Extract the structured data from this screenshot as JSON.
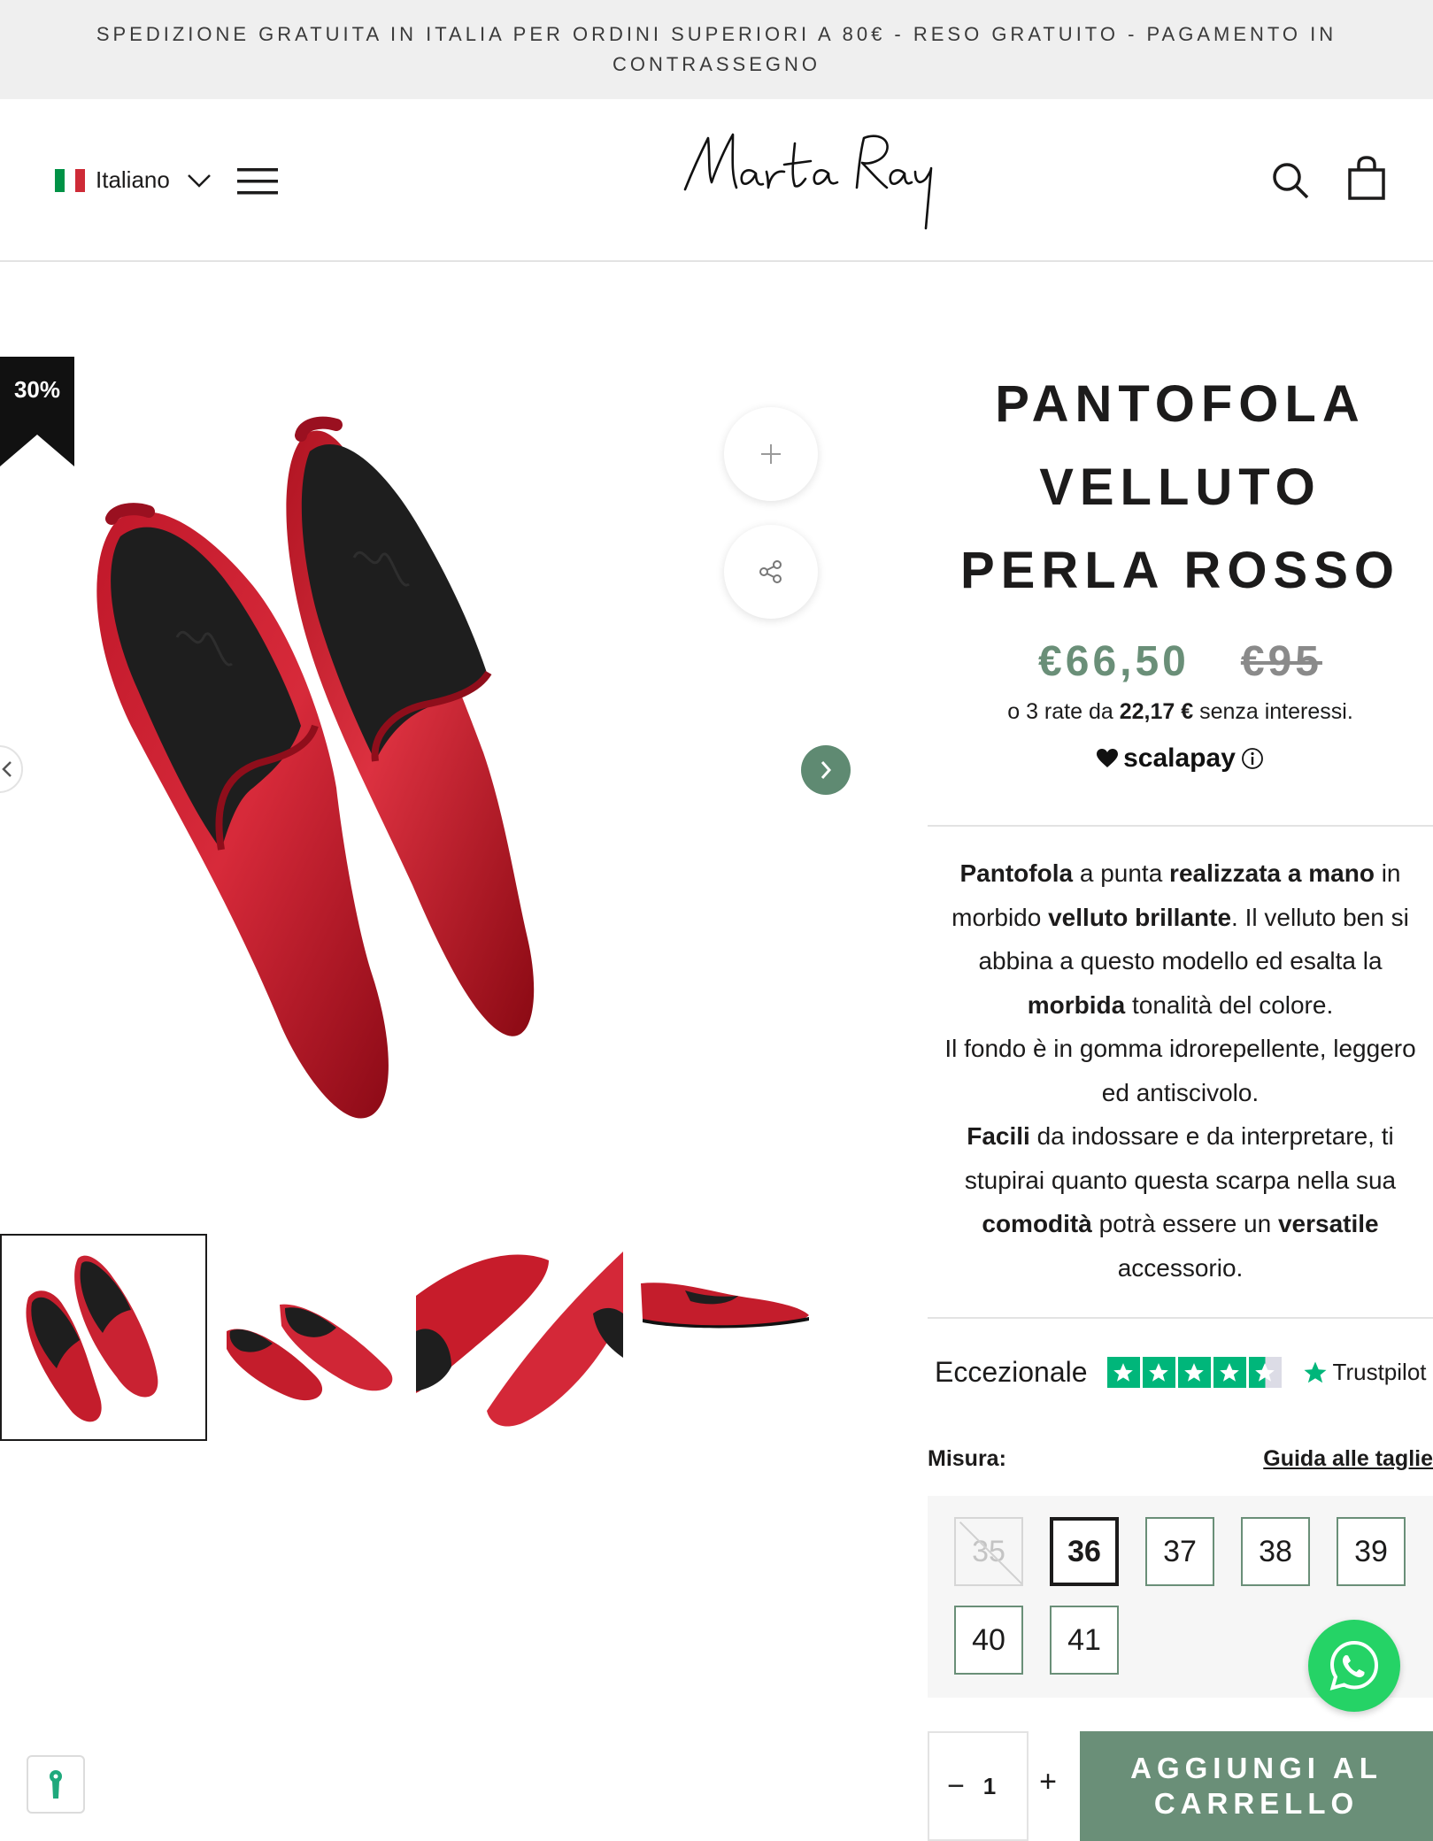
{
  "announcement": "SPEDIZIONE GRATUITA IN ITALIA PER ORDINI SUPERIORI A 80€ - RESO GRATUITO - PAGAMENTO IN CONTRASSEGNO",
  "header": {
    "language": "Italiano",
    "logo_text": "Marta Ray"
  },
  "gallery": {
    "discount_badge": "30%",
    "thumbnail_count": 4,
    "active_thumbnail": 1
  },
  "product": {
    "title_lines": [
      "PANTOFOLA",
      "VELLUTO",
      "PERLA ROSSO"
    ],
    "price_now": "€66,50",
    "price_old": "€95",
    "installments_prefix": "o 3 rate da ",
    "installments_amount": "22,17 €",
    "installments_suffix": " senza interessi.",
    "scalapay_label": "scalapay",
    "description": {
      "p1_a": "Pantofola",
      "p1_b": " a punta ",
      "p1_c": "realizzata a mano",
      "p1_d": " in morbido ",
      "p1_e": "velluto brillante",
      "p1_f": ". Il velluto ben si abbina a questo modello  ed esalta la ",
      "p1_g": "morbida",
      "p1_h": "  tonalità del colore.",
      "p2": "Il fondo è in gomma idrorepellente, leggero ed antiscivolo.",
      "p3_a": "Facili",
      "p3_b": " da indossare e da interpretare,  ti stupirai quanto questa scarpa nella sua ",
      "p3_c": "comodità",
      "p3_d": " potrà essere un ",
      "p3_e": "versatile",
      "p3_f": " accessorio."
    },
    "trustpilot_rating_label": "Eccezionale",
    "trustpilot_stars": 4.5,
    "trustpilot_brand": "Trustpilot",
    "size_label": "Misura:",
    "size_guide_label": "Guida alle taglie",
    "sizes": [
      {
        "label": "35",
        "state": "disabled"
      },
      {
        "label": "36",
        "state": "selected"
      },
      {
        "label": "37",
        "state": "available"
      },
      {
        "label": "38",
        "state": "available"
      },
      {
        "label": "39",
        "state": "available"
      },
      {
        "label": "40",
        "state": "available"
      },
      {
        "label": "41",
        "state": "available"
      }
    ],
    "quantity": "1",
    "qty_minus": "−",
    "qty_plus": "+",
    "add_to_cart": "AGGIUNGI AL CARRELLO"
  },
  "colors": {
    "accent": "#6a8f78",
    "velvet_red": "#b3141f",
    "trustpilot_green": "#00b67a",
    "whatsapp_green": "#25d366"
  }
}
